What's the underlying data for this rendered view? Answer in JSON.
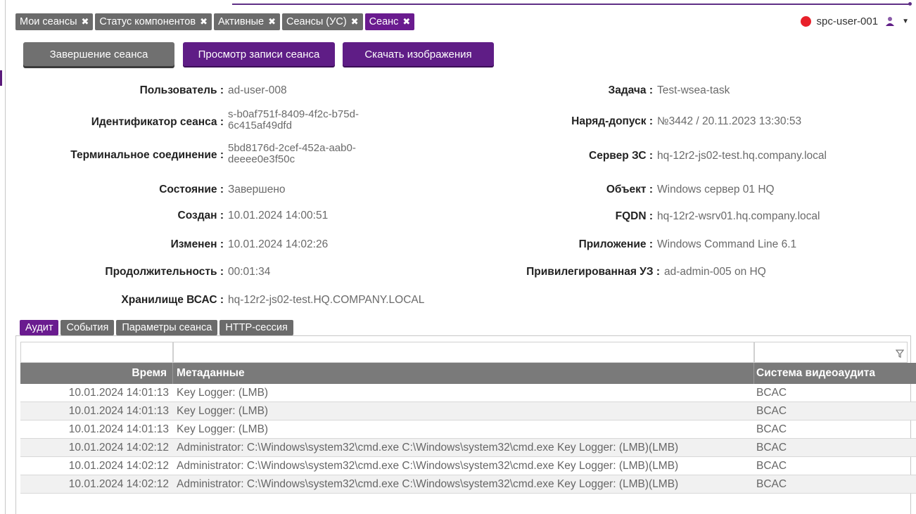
{
  "tabs": [
    {
      "label": "Мои сеансы",
      "active": false
    },
    {
      "label": "Статус компонентов",
      "active": false
    },
    {
      "label": "Активные",
      "active": false
    },
    {
      "label": "Сеансы (УС)",
      "active": false
    },
    {
      "label": "Сеанс",
      "active": true
    }
  ],
  "user": {
    "name": "spc-user-001",
    "status_color": "#e8202a"
  },
  "actions": {
    "end_session": "Завершение сеанса",
    "view_recording": "Просмотр записи сеанса",
    "download_images": "Скачать изображения"
  },
  "session": {
    "left": [
      {
        "label": "Пользователь :",
        "value": "ad-user-008"
      },
      {
        "label": "Идентификатор сеанса :",
        "value": "s-b0af751f-8409-4f2c-b75d-6c415af49dfd"
      },
      {
        "label": "Терминальное соединение :",
        "value": "5bd8176d-2cef-452a-aab0-deeee0e3f50c"
      },
      {
        "label": "Состояние :",
        "value": "Завершено"
      },
      {
        "label": "Создан :",
        "value": "10.01.2024 14:00:51"
      },
      {
        "label": "Изменен :",
        "value": "10.01.2024 14:02:26"
      },
      {
        "label": "Продолжительность :",
        "value": "00:01:34"
      },
      {
        "label": "Хранилище ВСАС :",
        "value": "hq-12r2-js02-test.HQ.COMPANY.LOCAL"
      }
    ],
    "right": [
      {
        "label": "Задача :",
        "value": "Test-wsea-task"
      },
      {
        "label": "Наряд-допуск :",
        "value": "№3442 / 20.11.2023 13:30:53"
      },
      {
        "label": "Сервер ЗС :",
        "value": "hq-12r2-js02-test.hq.company.local"
      },
      {
        "label": "Объект :",
        "value": "Windows сервер 01 HQ"
      },
      {
        "label": "FQDN :",
        "value": "hq-12r2-wsrv01.hq.company.local"
      },
      {
        "label": "Приложение :",
        "value": "Windows Command Line 6.1"
      },
      {
        "label": "Привилегированная УЗ :",
        "value": "ad-admin-005 on HQ"
      }
    ]
  },
  "subtabs": [
    {
      "label": "Аудит",
      "active": true
    },
    {
      "label": "События",
      "active": false
    },
    {
      "label": "Параметры сеанса",
      "active": false
    },
    {
      "label": "HTTP-сессия",
      "active": false
    }
  ],
  "audit_table": {
    "headers": [
      "Время",
      "Метаданные",
      "Система видеоаудита"
    ],
    "rows": [
      [
        "10.01.2024 14:01:13",
        "Key Logger: (LMB)",
        "BCAC"
      ],
      [
        "10.01.2024 14:01:13",
        "Key Logger: (LMB)",
        "BCAC"
      ],
      [
        "10.01.2024 14:01:13",
        "Key Logger: (LMB)",
        "BCAC"
      ],
      [
        "10.01.2024 14:02:12",
        "Administrator: C:\\Windows\\system32\\cmd.exe C:\\Windows\\system32\\cmd.exe Key Logger: (LMB)(LMB)",
        "BCAC"
      ],
      [
        "10.01.2024 14:02:12",
        "Administrator: C:\\Windows\\system32\\cmd.exe C:\\Windows\\system32\\cmd.exe Key Logger: (LMB)(LMB)",
        "BCAC"
      ],
      [
        "10.01.2024 14:02:12",
        "Administrator: C:\\Windows\\system32\\cmd.exe C:\\Windows\\system32\\cmd.exe Key Logger: (LMB)(LMB)",
        "BCAC"
      ]
    ]
  }
}
